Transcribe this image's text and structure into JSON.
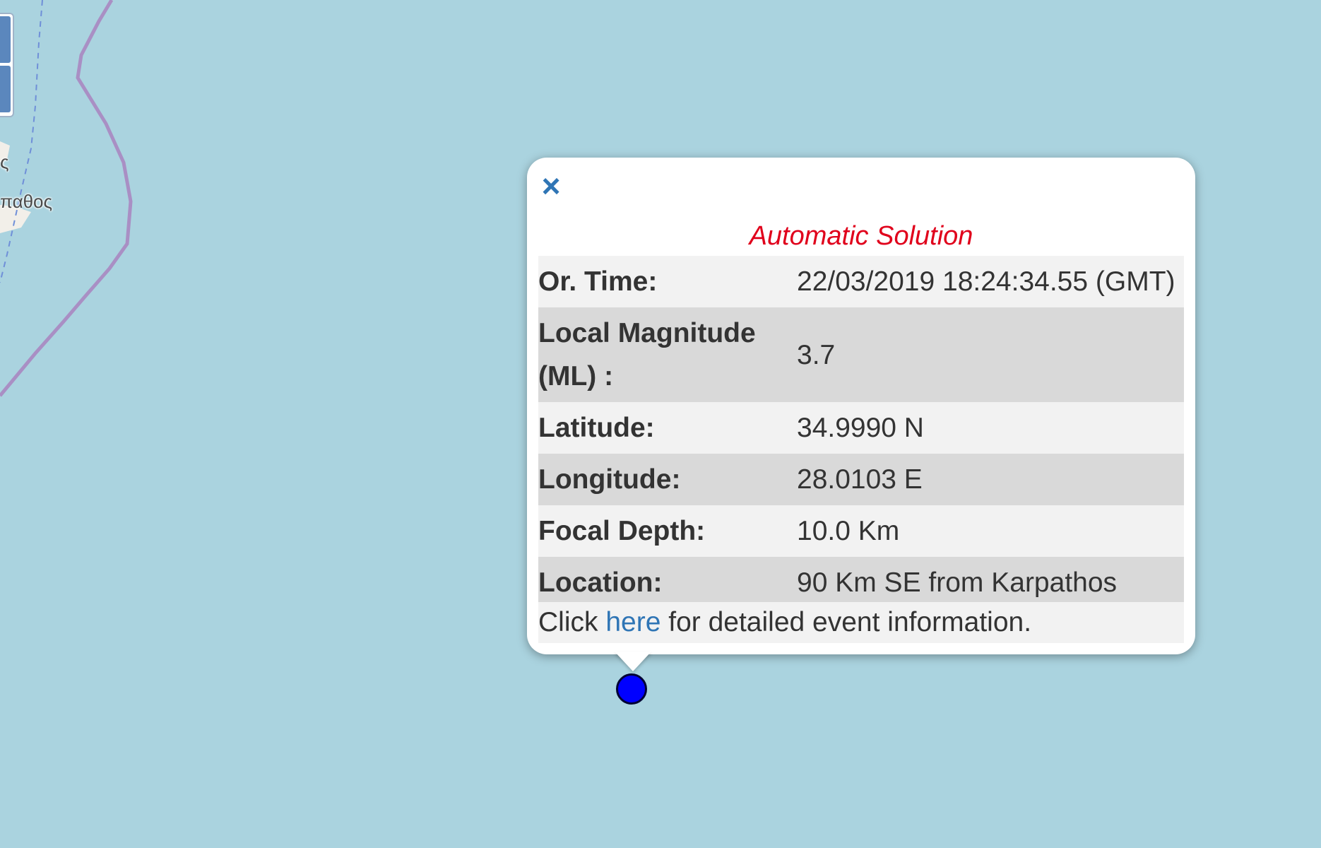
{
  "map": {
    "place_labels": [
      "ς",
      "παθος"
    ]
  },
  "popup": {
    "close_symbol": "×",
    "title": "Automatic Solution",
    "rows": [
      {
        "label": "Or. Time:",
        "value": "22/03/2019 18:24:34.55 (GMT)"
      },
      {
        "label": "Local Magnitude (ML) :",
        "value": "3.7"
      },
      {
        "label": "Latitude:",
        "value": "34.9990 N"
      },
      {
        "label": "Longitude:",
        "value": "28.0103 E"
      },
      {
        "label": "Focal Depth:",
        "value": "10.0 Km"
      },
      {
        "label": "Location:",
        "value": "90 Km SE from Karpathos"
      }
    ],
    "footer_prefix": "Click ",
    "footer_link": "here",
    "footer_suffix": " for detailed event information."
  },
  "colors": {
    "sea": "#aad3df",
    "land": "#f2efe9",
    "border": "#a98fc4",
    "marker": "#0000ff",
    "title": "#e0001b",
    "link": "#2f75b5"
  }
}
